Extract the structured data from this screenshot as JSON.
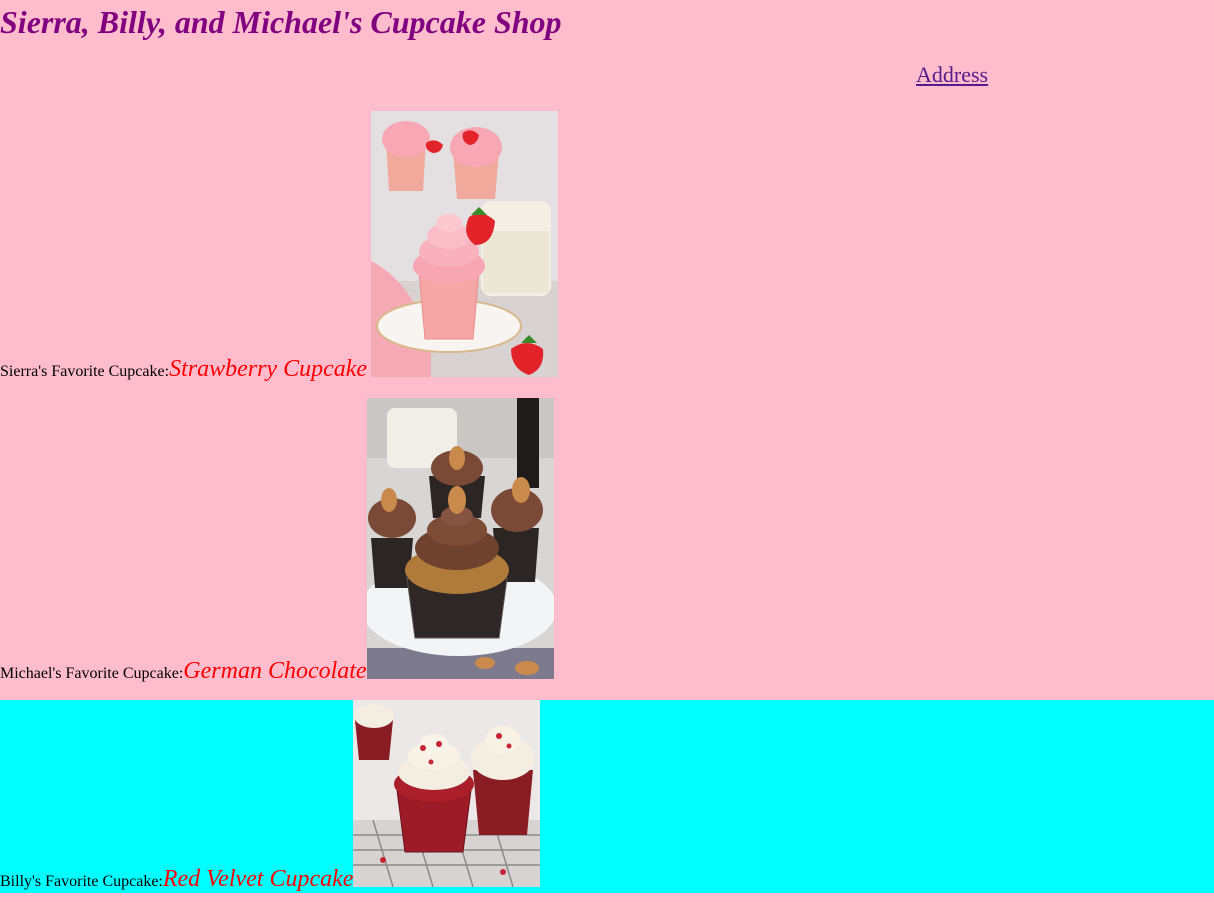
{
  "header": {
    "title": "Sierra, Billy, and Michael's Cupcake Shop",
    "address_link": "Address"
  },
  "favorites": [
    {
      "label": "Sierra's Favorite Cupcake: ",
      "cupcake": "Strawberry Cupcake"
    },
    {
      "label": "Michael's Favorite Cupcake: ",
      "cupcake": "German Chocolate"
    },
    {
      "label": "Billy's Favorite Cupcake: ",
      "cupcake": "Red Velvet Cupcake"
    }
  ],
  "colors": {
    "page_background": "#ffbccd",
    "title": "#800080",
    "link": "#551a8b",
    "cupcake_name": "#ff0000",
    "billy_highlight": "#00ffff"
  },
  "images": [
    {
      "icon": "strawberry-cupcake-photo"
    },
    {
      "icon": "german-chocolate-cupcake-photo"
    },
    {
      "icon": "red-velvet-cupcake-photo"
    }
  ]
}
